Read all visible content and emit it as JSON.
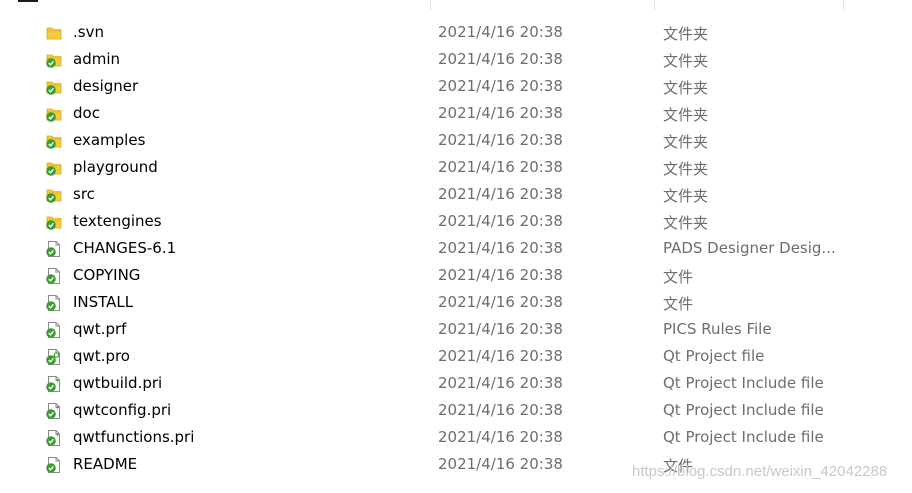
{
  "files": [
    {
      "name": ".svn",
      "date": "2021/4/16 20:38",
      "type": "文件夹",
      "icon": "folder-icon"
    },
    {
      "name": "admin",
      "date": "2021/4/16 20:38",
      "type": "文件夹",
      "icon": "folder-svn-ok-icon"
    },
    {
      "name": "designer",
      "date": "2021/4/16 20:38",
      "type": "文件夹",
      "icon": "folder-svn-ok-icon"
    },
    {
      "name": "doc",
      "date": "2021/4/16 20:38",
      "type": "文件夹",
      "icon": "folder-svn-ok-icon"
    },
    {
      "name": "examples",
      "date": "2021/4/16 20:38",
      "type": "文件夹",
      "icon": "folder-svn-ok-icon"
    },
    {
      "name": "playground",
      "date": "2021/4/16 20:38",
      "type": "文件夹",
      "icon": "folder-svn-ok-icon"
    },
    {
      "name": "src",
      "date": "2021/4/16 20:38",
      "type": "文件夹",
      "icon": "folder-svn-ok-icon"
    },
    {
      "name": "textengines",
      "date": "2021/4/16 20:38",
      "type": "文件夹",
      "icon": "folder-svn-ok-icon"
    },
    {
      "name": "CHANGES-6.1",
      "date": "2021/4/16 20:38",
      "type": "PADS Designer Desig...",
      "icon": "file-svn-ok-icon"
    },
    {
      "name": "COPYING",
      "date": "2021/4/16 20:38",
      "type": "文件",
      "icon": "file-svn-ok-icon"
    },
    {
      "name": "INSTALL",
      "date": "2021/4/16 20:38",
      "type": "文件",
      "icon": "file-svn-ok-icon"
    },
    {
      "name": "qwt.prf",
      "date": "2021/4/16 20:38",
      "type": "PICS Rules File",
      "icon": "file-svn-ok-icon"
    },
    {
      "name": "qwt.pro",
      "date": "2021/4/16 20:38",
      "type": "Qt Project file",
      "icon": "qt-file-svn-ok-icon"
    },
    {
      "name": "qwtbuild.pri",
      "date": "2021/4/16 20:38",
      "type": "Qt Project Include file",
      "icon": "qt-include-file-svn-ok-icon"
    },
    {
      "name": "qwtconfig.pri",
      "date": "2021/4/16 20:38",
      "type": "Qt Project Include file",
      "icon": "qt-include-file-svn-ok-icon"
    },
    {
      "name": "qwtfunctions.pri",
      "date": "2021/4/16 20:38",
      "type": "Qt Project Include file",
      "icon": "qt-include-file-svn-ok-icon"
    },
    {
      "name": "README",
      "date": "2021/4/16 20:38",
      "type": "文件",
      "icon": "file-svn-ok-icon"
    }
  ],
  "watermark": "https://blog.csdn.net/weixin_42042288",
  "colors": {
    "folder": "#f5c93e",
    "folder_dark": "#dcae22",
    "svn_ok": "#3a9e2f",
    "file_bg": "#ffffff",
    "file_border": "#8a8a8a",
    "meta_text": "#6d6d6d"
  }
}
